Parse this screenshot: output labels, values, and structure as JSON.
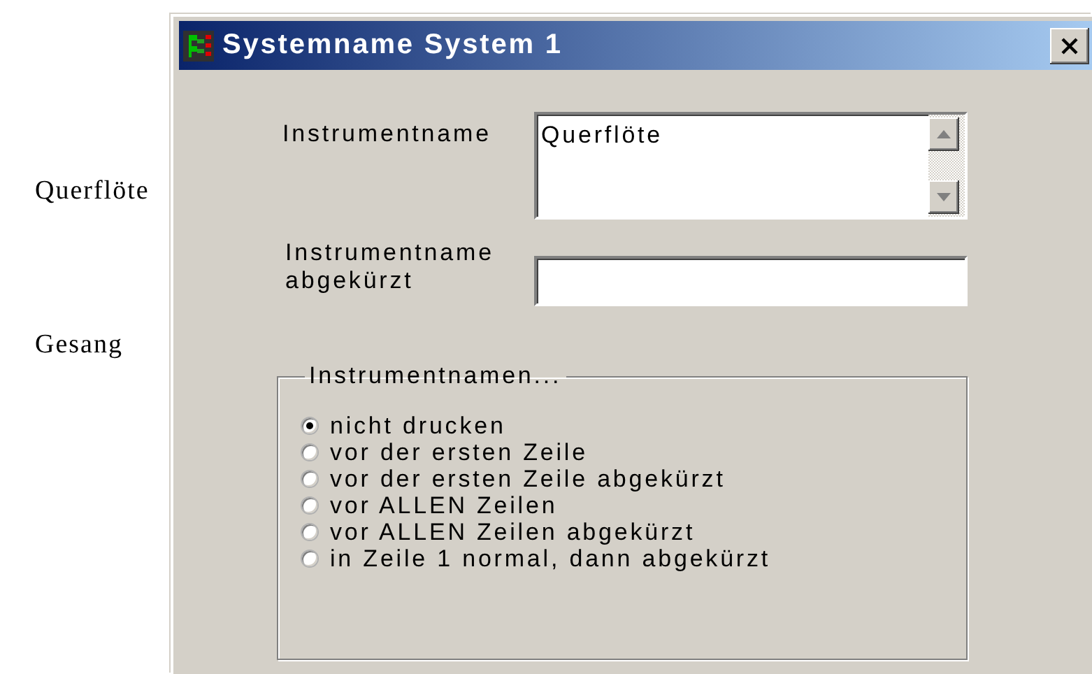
{
  "staff_labels": [
    "Querflöte",
    "Gesang"
  ],
  "window": {
    "title": "Systemname System 1"
  },
  "instrument_name": {
    "label": "Instrumentname",
    "value": "Querflöte"
  },
  "abbreviated_name": {
    "label": "Instrumentname abgekürzt"
  },
  "names_group": {
    "title": "Instrumentnamen...",
    "options": [
      {
        "label": "nicht drucken",
        "selected": true
      },
      {
        "label": "vor der ersten Zeile",
        "selected": false
      },
      {
        "label": "vor der ersten Zeile abgekürzt",
        "selected": false
      },
      {
        "label": "vor ALLEN Zeilen",
        "selected": false
      },
      {
        "label": "vor ALLEN Zeilen abgekürzt",
        "selected": false
      },
      {
        "label": "in Zeile 1 normal, dann abgekürzt",
        "selected": false
      }
    ]
  }
}
